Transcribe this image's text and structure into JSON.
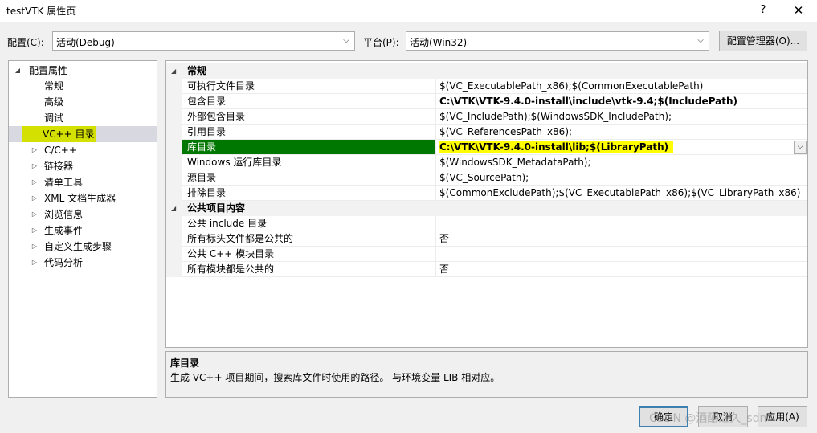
{
  "window": {
    "title": "testVTK 属性页",
    "help": "?",
    "close": "✕"
  },
  "config": {
    "config_label": "配置(C):",
    "config_value": "活动(Debug)",
    "platform_label": "平台(P):",
    "platform_value": "活动(Win32)",
    "manager_button": "配置管理器(O)..."
  },
  "tree": {
    "root": "配置属性",
    "items": [
      "常规",
      "高级",
      "调试",
      "VC++ 目录",
      "C/C++",
      "链接器",
      "清单工具",
      "XML 文档生成器",
      "浏览信息",
      "生成事件",
      "自定义生成步骤",
      "代码分析"
    ]
  },
  "grid": {
    "cat_general": "常规",
    "rows_general": [
      {
        "name": "可执行文件目录",
        "value": "$(VC_ExecutablePath_x86);$(CommonExecutablePath)"
      },
      {
        "name": "包含目录",
        "value": "C:\\VTK\\VTK-9.4.0-install\\include\\vtk-9.4;$(IncludePath)"
      },
      {
        "name": "外部包含目录",
        "value": "$(VC_IncludePath);$(WindowsSDK_IncludePath);"
      },
      {
        "name": "引用目录",
        "value": "$(VC_ReferencesPath_x86);"
      },
      {
        "name": "库目录",
        "value": "C:\\VTK\\VTK-9.4.0-install\\lib;$(LibraryPath)"
      },
      {
        "name": "Windows 运行库目录",
        "value": "$(WindowsSDK_MetadataPath);"
      },
      {
        "name": "源目录",
        "value": "$(VC_SourcePath);"
      },
      {
        "name": "排除目录",
        "value": "$(CommonExcludePath);$(VC_ExecutablePath_x86);$(VC_LibraryPath_x86)"
      }
    ],
    "cat_public": "公共项目内容",
    "rows_public": [
      {
        "name": "公共 include 目录",
        "value": ""
      },
      {
        "name": "所有标头文件都是公共的",
        "value": "否"
      },
      {
        "name": "公共 C++ 模块目录",
        "value": ""
      },
      {
        "name": "所有模块都是公共的",
        "value": "否"
      }
    ]
  },
  "description": {
    "title": "库目录",
    "text": "生成 VC++ 项目期间，搜索库文件时使用的路径。 与环境变量 LIB 相对应。"
  },
  "buttons": {
    "ok": "确定",
    "cancel": "取消",
    "apply": "应用(A)"
  },
  "watermark": "CSDN @酒酣之久_sdn",
  "colors": {
    "selected_name_bg": "#007700",
    "selected_value_highlight": "#ffff00",
    "tree_selected_highlight": "#d4e000"
  }
}
